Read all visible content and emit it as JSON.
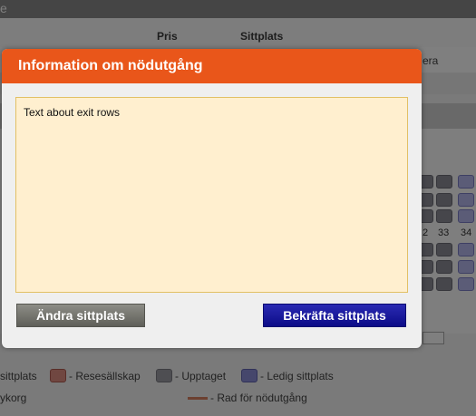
{
  "background": {
    "header_text": "e",
    "col_price": "Pris",
    "col_seat": "Sittplats",
    "partial_text": "era",
    "row_numbers": [
      "2",
      "33",
      "34"
    ],
    "legend": {
      "seat": "sittplats",
      "travel_company": "- Resesällskap",
      "taken": "- Upptaget",
      "free_seat": "- Ledig sittplats",
      "basket": "ykorg",
      "exit_row": "- Rad för nödutgång"
    }
  },
  "modal": {
    "title": "Information om nödutgång",
    "body_text": "Text about exit rows",
    "change_button": "Ändra sittplats",
    "confirm_button": "Bekräfta sittplats"
  },
  "colors": {
    "header": "#e9561a",
    "body_bg": "#ffefcf",
    "confirm": "#0c0c88",
    "change": "#6b6b64"
  }
}
